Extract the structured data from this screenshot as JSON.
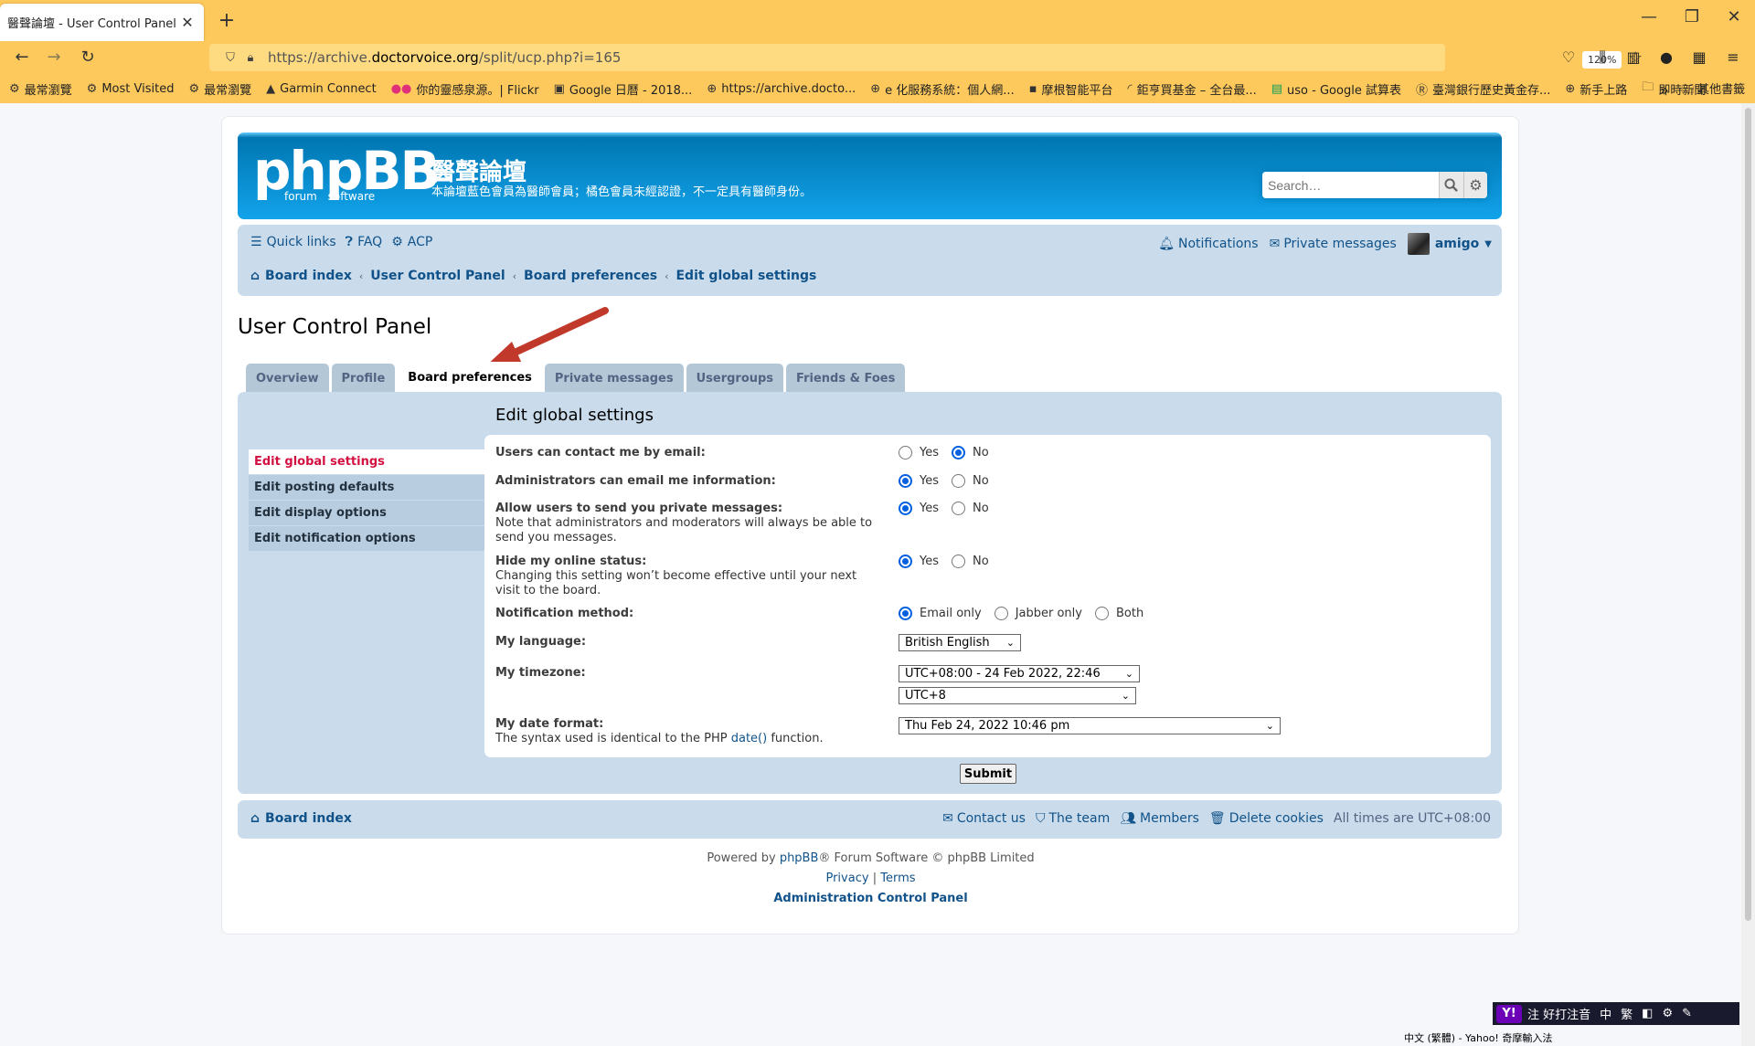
{
  "browser": {
    "tab_title": "醫聲論壇 - User Control Panel - Edit",
    "url_prefix": "https://archive.",
    "url_domain": "doctorvoice.org",
    "url_path": "/split/ucp.php?i=165",
    "zoom": "120%",
    "bookmarks": [
      {
        "icon": "gear-icon",
        "label": "最常瀏覽"
      },
      {
        "icon": "gear-icon",
        "label": "Most Visited"
      },
      {
        "icon": "gear-icon",
        "label": "最常瀏覽"
      },
      {
        "icon": "garmin-icon",
        "label": "Garmin Connect"
      },
      {
        "icon": "flickr-icon",
        "label": "你的靈感泉源。| Flickr"
      },
      {
        "icon": "calendar-icon",
        "label": "Google 日曆 - 2018..."
      },
      {
        "icon": "globe-icon",
        "label": "https://archive.docto..."
      },
      {
        "icon": "globe-icon",
        "label": "e 化服務系統：個人網..."
      },
      {
        "icon": "jpm-icon",
        "label": "摩根智能平台"
      },
      {
        "icon": "rainbow-icon",
        "label": "鉅亨買基金 – 全台最..."
      },
      {
        "icon": "sheets-icon",
        "label": "uso - Google 試算表"
      },
      {
        "icon": "bank-icon",
        "label": "臺灣銀行歷史黃金存..."
      },
      {
        "icon": "globe-icon",
        "label": "新手上路"
      },
      {
        "icon": "folder-icon",
        "label": "即時新聞"
      }
    ],
    "other_bookmarks": "其他書籤"
  },
  "header": {
    "logo_main": "phpBB",
    "logo_sub": "forum software",
    "site_title": "醫聲論壇",
    "site_desc": "本論壇藍色會員為醫師會員；橘色會員未經認證，不一定具有醫師身份。",
    "search_placeholder": "Search…"
  },
  "nav": {
    "quick_links": "Quick links",
    "faq": "FAQ",
    "acp": "ACP",
    "notifications": "Notifications",
    "private_messages": "Private messages",
    "username": "amigo"
  },
  "breadcrumbs": [
    "Board index",
    "User Control Panel",
    "Board preferences",
    "Edit global settings"
  ],
  "page_title": "User Control Panel",
  "tabs": [
    {
      "label": "Overview",
      "active": false
    },
    {
      "label": "Profile",
      "active": false
    },
    {
      "label": "Board preferences",
      "active": true
    },
    {
      "label": "Private messages",
      "active": false
    },
    {
      "label": "Usergroups",
      "active": false
    },
    {
      "label": "Friends & Foes",
      "active": false
    }
  ],
  "sidebar": [
    {
      "label": "Edit global settings",
      "active": true
    },
    {
      "label": "Edit posting defaults",
      "active": false
    },
    {
      "label": "Edit display options",
      "active": false
    },
    {
      "label": "Edit notification options",
      "active": false
    }
  ],
  "form": {
    "title": "Edit global settings",
    "email_contact": {
      "label": "Users can contact me by email:",
      "yes": "Yes",
      "no": "No",
      "selected": "No"
    },
    "admin_email": {
      "label": "Administrators can email me information:",
      "yes": "Yes",
      "no": "No",
      "selected": "Yes"
    },
    "allow_pm": {
      "label": "Allow users to send you private messages:",
      "explain": "Note that administrators and moderators will always be able to send you messages.",
      "yes": "Yes",
      "no": "No",
      "selected": "Yes"
    },
    "hide_online": {
      "label": "Hide my online status:",
      "explain": "Changing this setting won’t become effective until your next visit to the board.",
      "yes": "Yes",
      "no": "No",
      "selected": "Yes"
    },
    "notify_method": {
      "label": "Notification method:",
      "options": [
        "Email only",
        "Jabber only",
        "Both"
      ],
      "selected": "Email only"
    },
    "language": {
      "label": "My language:",
      "value": "British English"
    },
    "timezone": {
      "label": "My timezone:",
      "value1": "UTC+08:00 - 24 Feb 2022, 22:46",
      "value2": "UTC+8"
    },
    "date_format": {
      "label": "My date format:",
      "explain_pre": "The syntax used is identical to the PHP ",
      "explain_link": "date()",
      "explain_post": " function.",
      "value": "Thu Feb 24, 2022 10:46 pm"
    },
    "submit": "Submit"
  },
  "footer": {
    "board_index": "Board index",
    "contact": "Contact us",
    "team": "The team",
    "members": "Members",
    "delete_cookies": "Delete cookies",
    "timezone": "All times are UTC+08:00",
    "powered_pre": "Powered by ",
    "powered_link": "phpBB",
    "powered_post": "® Forum Software © phpBB Limited",
    "privacy": "Privacy",
    "pipe": "|",
    "terms": "Terms",
    "acp": "Administration Control Panel"
  },
  "ime": {
    "mode": "注 好打注音",
    "lang": "中",
    "trad": "繁",
    "status": "中文 (繁體) - Yahoo! 奇摩輸入法"
  },
  "colors": {
    "brand_header": "#12a3eb",
    "link": "#105289",
    "active_side": "#d31141",
    "arrow": "#c0392b"
  }
}
